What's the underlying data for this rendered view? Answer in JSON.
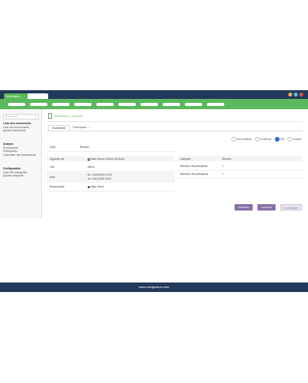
{
  "app": {
    "logo_text": "NextGestion",
    "window_dots": [
      "#f0ad4e",
      "#5bc0de",
      "#d9534f"
    ]
  },
  "colors": {
    "header": "#23395b",
    "accent": "#5cb85c",
    "button_purple": "#8a6fa8",
    "button_light": "#e9e4ef"
  },
  "sidebar": {
    "search_placeholder": "Rechercher",
    "groups": [
      {
        "heading": "Liste des événements",
        "items": [
          "Liste des événements",
          "Ajouter événement"
        ]
      },
      {
        "heading": "Analyse",
        "items": [
          "Evénements",
          "Participants",
          "Calendrier des événements"
        ]
      },
      {
        "heading": "Configuration",
        "items": [
          "Liste des catégories",
          "Ajouter catégorie"
        ]
      }
    ]
  },
  "breadcrumb": {
    "text": "Evénement > Réunion"
  },
  "tabs": [
    {
      "label": "Evénement",
      "badge": ""
    },
    {
      "label": "Participants",
      "badge": "0"
    }
  ],
  "status": {
    "options": [
      "Non confirmé",
      "Confirmer",
      "Fait",
      "Annuler"
    ],
    "selected": "Fait"
  },
  "event": {
    "subject_label": "Sujet",
    "subject_value": "Réunion",
    "left_fields": [
      {
        "label": "Organisé par",
        "value": "Mark Simon A.Kevin (A.Kevin)"
      },
      {
        "label": "Lieu",
        "value": "Maroc"
      },
      {
        "label": "Date",
        "value": "De: 15/05/2019 10:00",
        "value2": "au: 24/11/2019 10:00"
      },
      {
        "label": "Responsable",
        "value": "Mark Simon"
      }
    ],
    "right_fields": [
      {
        "label": "Catégorie",
        "value": "Réunion"
      },
      {
        "label": "Minimum de participants",
        "value": "1"
      },
      {
        "label": "Maximum de participants",
        "value": "1"
      }
    ]
  },
  "actions": {
    "modify": "MODIFIER",
    "cancel": "ANNULER",
    "delete": "SUPPRIMER"
  },
  "footer": {
    "text": "www.nextgestion.com"
  }
}
